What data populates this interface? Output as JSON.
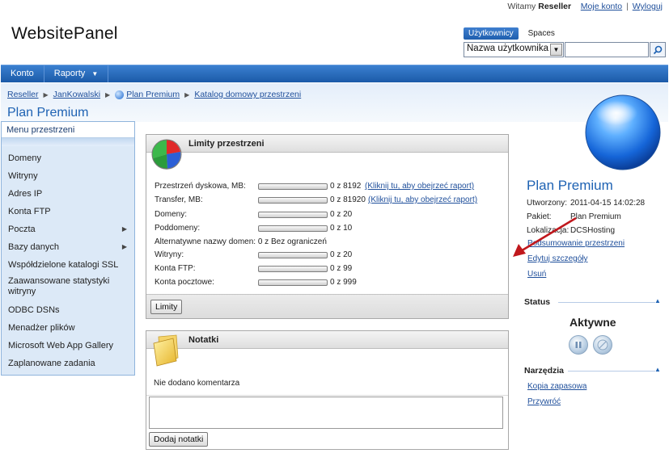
{
  "header": {
    "welcome": "Witamy",
    "user": "Reseller",
    "my_account": "Moje konto",
    "separator": "|",
    "logout": "Wyloguj",
    "brand": "WebsitePanel"
  },
  "search": {
    "tab_users": "Użytkownicy",
    "tab_spaces": "Spaces",
    "select_value": "Nazwa użytkownika",
    "input_value": "",
    "input_placeholder": ""
  },
  "nav": {
    "items": [
      {
        "label": "Konto"
      },
      {
        "label": "Raporty"
      }
    ]
  },
  "breadcrumb": {
    "items": [
      "Reseller",
      "JanKowalski",
      "Plan Premium",
      "Katalog domowy przestrzeni"
    ]
  },
  "page": {
    "title": "Plan Premium"
  },
  "menu": {
    "title": "Menu przestrzeni",
    "items": [
      {
        "label": "Domeny"
      },
      {
        "label": "Witryny"
      },
      {
        "label": "Adres IP"
      },
      {
        "label": "Konta FTP"
      },
      {
        "label": "Poczta"
      },
      {
        "label": "Bazy danych"
      },
      {
        "label": "Współdzielone katalogi SSL"
      },
      {
        "label": "Zaawansowane statystyki witryny"
      },
      {
        "label": "ODBC DSNs"
      },
      {
        "label": "Menadżer plików"
      },
      {
        "label": "Microsoft Web App Gallery"
      },
      {
        "label": "Zaplanowane zadania"
      }
    ]
  },
  "limits": {
    "title": "Limity przestrzeni",
    "rows": [
      {
        "label": "Przestrzeń dyskowa, MB:",
        "value": "0 z 8192",
        "usage": 0,
        "link": "(Kliknij tu, aby obejrzeć raport)"
      },
      {
        "label": "Transfer, MB:",
        "value": "0 z 81920",
        "usage": 0,
        "link": "(Kliknij tu, aby obejrzeć raport)"
      },
      {
        "label": "Domeny:",
        "value": "0 z 20",
        "usage": 0
      },
      {
        "label": "Poddomeny:",
        "value": "0 z 10",
        "usage": 0
      },
      {
        "label": "Witryny:",
        "value": "0 z 20",
        "usage": 0
      },
      {
        "label": "Konta FTP:",
        "value": "0 z 99",
        "usage": 0
      },
      {
        "label": "Konta pocztowe:",
        "value": "0 z 999",
        "usage": 0
      }
    ],
    "alt_names": "Alternatywne nazwy domen: 0 z Bez ograniczeń",
    "button": "Limity"
  },
  "notes": {
    "title": "Notatki",
    "empty_text": "Nie dodano komentarza",
    "textarea_value": "",
    "button": "Dodaj notatki"
  },
  "summary": {
    "title": "Plan Premium",
    "created_label": "Utworzony:",
    "created_value": "2011-04-15 14:02:28",
    "package_label": "Pakiet:",
    "package_value": "Plan Premium",
    "location_label": "Lokalizacja:",
    "location_value": "DCSHosting",
    "link_summary": "Podsumowanie przestrzeni",
    "link_edit": "Edytuj szczegóły",
    "link_delete": "Usuń"
  },
  "status": {
    "title": "Status",
    "value": "Aktywne"
  },
  "tools": {
    "title": "Narzędzia",
    "backup": "Kopia zapasowa",
    "restore": "Przywróć"
  },
  "colors": {
    "nav_bar": "#1b5aa8",
    "title_blue": "#1e62b3",
    "link_blue": "#1f4f9b",
    "menu_bg": "#dce9f7",
    "arrow_red": "#c0181d"
  }
}
